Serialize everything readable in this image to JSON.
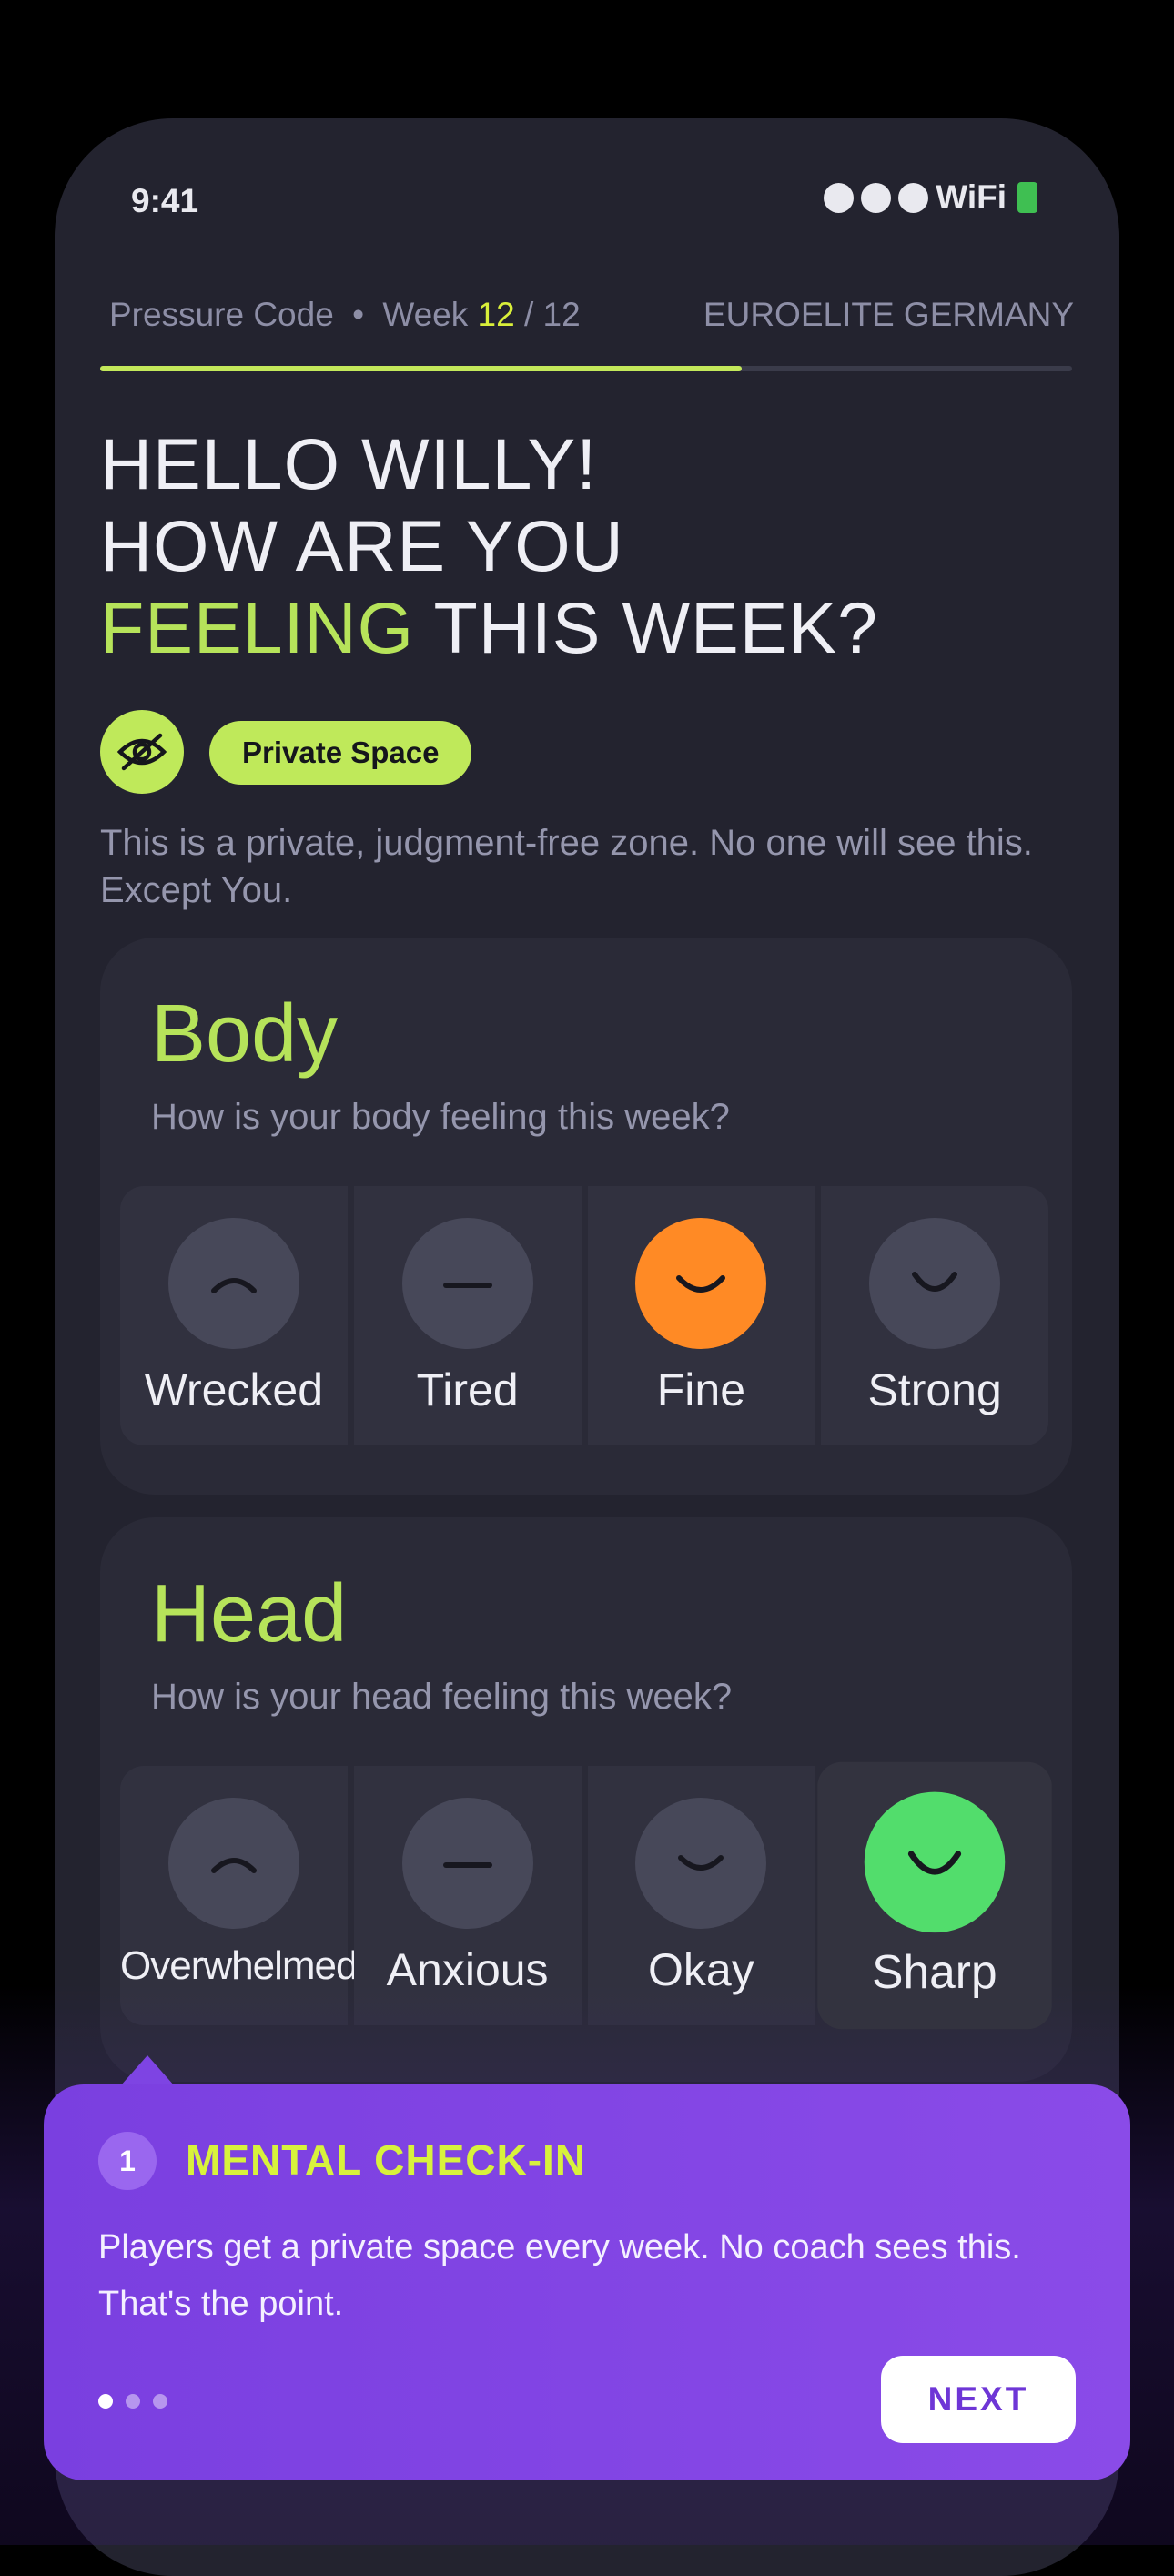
{
  "status_bar": {
    "time": "9:41",
    "wifi_label": "WiFi",
    "signal_icon": "signal-dots-icon",
    "battery_icon": "battery-icon"
  },
  "header": {
    "program": "Pressure Code",
    "separator": "•",
    "week_prefix": "Week",
    "week_current": "12",
    "week_sep": "/",
    "week_total": "12",
    "club": "EUROELITE GERMANY",
    "progress": 0.66
  },
  "greeting": {
    "line1": "HELLO WILLY!",
    "line2": "HOW ARE YOU",
    "line3_accent": "FEELING",
    "line3_rest": " THIS WEEK?"
  },
  "privacy": {
    "icon": "eye-off-icon",
    "pill_label": "Private Space",
    "description": "This is a private, judgment-free zone. No one will see this. Except You."
  },
  "body_card": {
    "title": "Body",
    "subtitle": "How is your body feeling this week?",
    "options": [
      {
        "label": "Wrecked",
        "face": "frown"
      },
      {
        "label": "Tired",
        "face": "neutral"
      },
      {
        "label": "Fine",
        "face": "smile",
        "selected": true
      },
      {
        "label": "Strong",
        "face": "smile"
      }
    ]
  },
  "head_card": {
    "title": "Head",
    "subtitle": "How is your head feeling this week?",
    "options": [
      {
        "label": "Overwhelmed",
        "face": "frown"
      },
      {
        "label": "Anxious",
        "face": "neutral"
      },
      {
        "label": "Okay",
        "face": "smile"
      },
      {
        "label": "Sharp",
        "face": "smile",
        "selected": true
      }
    ]
  },
  "tooltip": {
    "step": "1",
    "title": "MENTAL CHECK-IN",
    "body": "Players get a private space every week. No coach sees this. That's the point.",
    "pager_total": 3,
    "pager_active": 1,
    "next_label": "NEXT"
  },
  "colors": {
    "background": "#000000",
    "phone": "#23232f",
    "accent_lime": "#b6e35a",
    "accent_yellow": "#d9ef3a",
    "selected_orange": "#ff8a25",
    "selected_green": "#52dd6c",
    "tooltip_purple": "#7e44e3"
  }
}
